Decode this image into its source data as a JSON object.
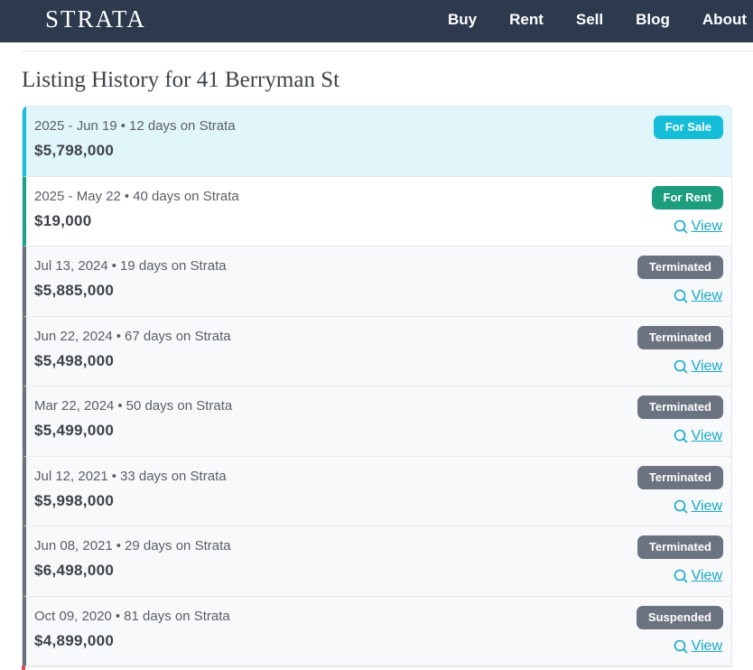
{
  "brand": {
    "logo": "STRATA"
  },
  "nav": {
    "items": [
      "Buy",
      "Rent",
      "Sell",
      "Blog",
      "About"
    ]
  },
  "page": {
    "title": "Listing History for 41 Berryman St",
    "view_label": "View",
    "currency_symbol": "$"
  },
  "colors": {
    "header_bg": "#2d3a4e",
    "for_sale": "#16bdd9",
    "for_rent": "#1b9d7e",
    "terminated": "#6b7280",
    "link": "#19a7c4"
  },
  "listings": [
    {
      "date": "2025 - Jun 19",
      "days": "12 days on Strata",
      "price": "5,798,000",
      "status": "For Sale",
      "type": "sale",
      "has_view": false
    },
    {
      "date": "2025 - May 22",
      "days": "40 days on Strata",
      "price": "19,000",
      "status": "For Rent",
      "type": "rent",
      "has_view": true
    },
    {
      "date": "Jul 13, 2024",
      "days": "19 days on Strata",
      "price": "5,885,000",
      "status": "Terminated",
      "type": "terminated",
      "has_view": true
    },
    {
      "date": "Jun 22, 2024",
      "days": "67 days on Strata",
      "price": "5,498,000",
      "status": "Terminated",
      "type": "terminated",
      "has_view": true
    },
    {
      "date": "Mar 22, 2024",
      "days": "50 days on Strata",
      "price": "5,499,000",
      "status": "Terminated",
      "type": "terminated",
      "has_view": true
    },
    {
      "date": "Jul 12, 2021",
      "days": "33 days on Strata",
      "price": "5,998,000",
      "status": "Terminated",
      "type": "terminated",
      "has_view": true
    },
    {
      "date": "Jun 08, 2021",
      "days": "29 days on Strata",
      "price": "6,498,000",
      "status": "Terminated",
      "type": "terminated",
      "has_view": true
    },
    {
      "date": "Oct 09, 2020",
      "days": "81 days on Strata",
      "price": "4,899,000",
      "status": "Suspended",
      "type": "terminated",
      "has_view": true
    }
  ]
}
